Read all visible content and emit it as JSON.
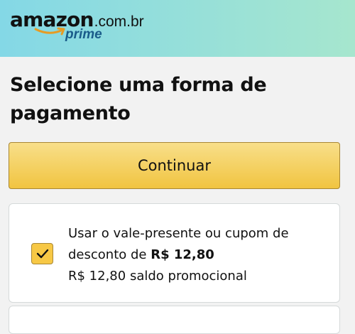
{
  "header": {
    "logo_main": "amazon",
    "logo_domain": ".com.br",
    "logo_sub": "prime",
    "colors": {
      "gradient_start": "#84d8e6",
      "gradient_end": "#a6e6ce"
    }
  },
  "page": {
    "title": "Selecione uma forma de pagamento"
  },
  "continue_button": {
    "label": "Continuar",
    "color": "#f1c440"
  },
  "gift_card_option": {
    "checked": true,
    "text_prefix": "Usar o vale-presente ou cupom de desconto de",
    "amount": "R$ 12,80",
    "balance_amount": "R$ 12,80",
    "balance_label": "saldo promocional",
    "checkbox_icon": "check-icon"
  }
}
